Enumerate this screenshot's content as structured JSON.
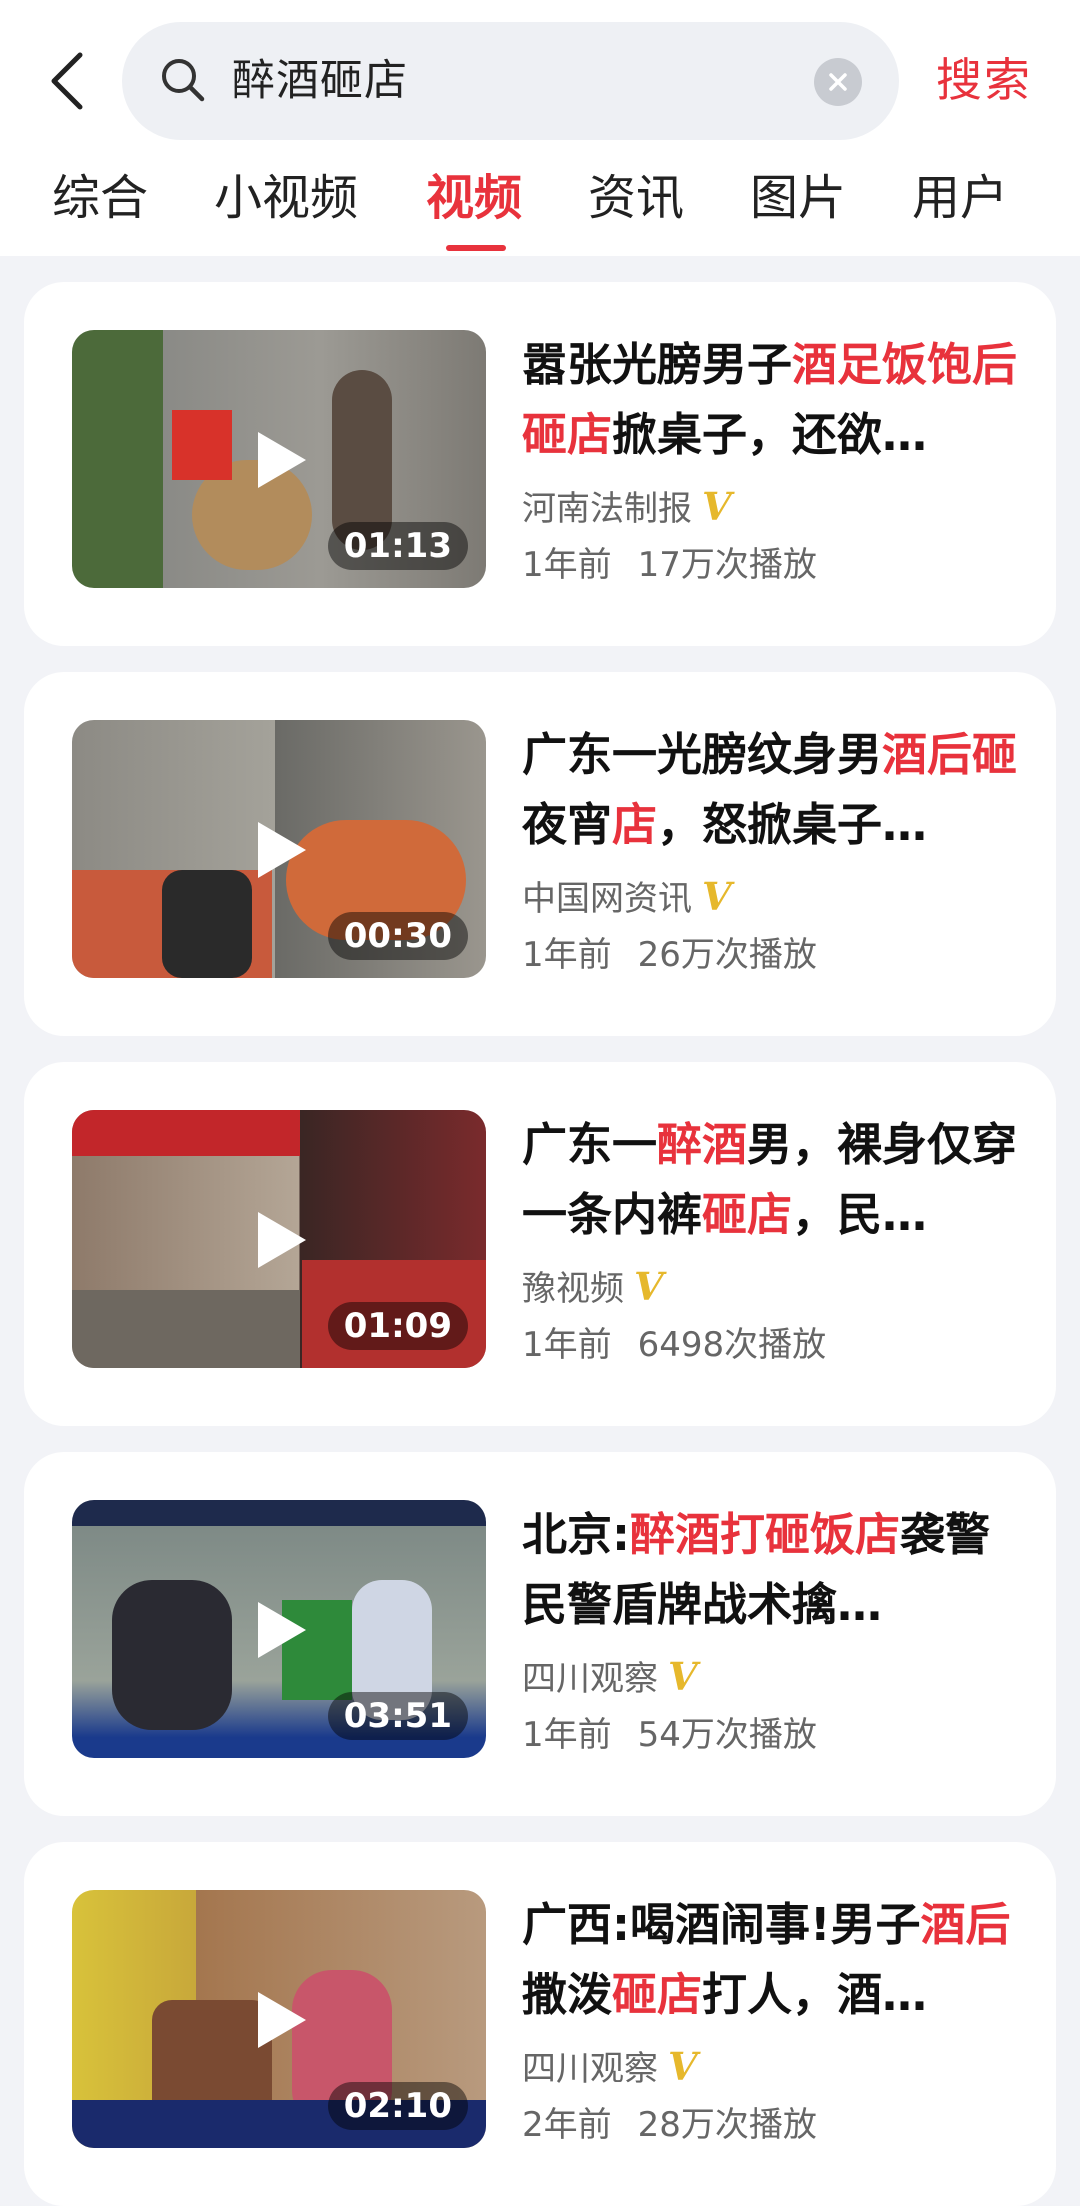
{
  "search": {
    "query": "醉酒砸店",
    "button_label": "搜索"
  },
  "tabs": [
    {
      "label": "综合"
    },
    {
      "label": "小视频"
    },
    {
      "label": "视频",
      "active": true
    },
    {
      "label": "资讯"
    },
    {
      "label": "图片"
    },
    {
      "label": "用户"
    }
  ],
  "colors": {
    "accent": "#e8323c",
    "verified": "#e6b82c"
  },
  "results": [
    {
      "title_parts": [
        {
          "text": "嚣张光膀男子",
          "hl": false
        },
        {
          "text": "酒足饭饱后砸店",
          "hl": true
        },
        {
          "text": "掀桌子，还欲…",
          "hl": false
        }
      ],
      "source": "河南法制报",
      "verified_mark": "V",
      "time": "1年前",
      "views": "17万次播放",
      "duration": "01:13"
    },
    {
      "title_parts": [
        {
          "text": "广东一光膀纹身男",
          "hl": false
        },
        {
          "text": "酒后砸",
          "hl": true
        },
        {
          "text": "夜宵",
          "hl": false
        },
        {
          "text": "店",
          "hl": true
        },
        {
          "text": "，怒掀桌子…",
          "hl": false
        }
      ],
      "source": "中国网资讯",
      "verified_mark": "V",
      "time": "1年前",
      "views": "26万次播放",
      "duration": "00:30"
    },
    {
      "title_parts": [
        {
          "text": "广东一",
          "hl": false
        },
        {
          "text": "醉酒",
          "hl": true
        },
        {
          "text": "男，裸身仅穿一条内裤",
          "hl": false
        },
        {
          "text": "砸店",
          "hl": true
        },
        {
          "text": "，民…",
          "hl": false
        }
      ],
      "source": "豫视频",
      "verified_mark": "V",
      "time": "1年前",
      "views": "6498次播放",
      "duration": "01:09"
    },
    {
      "title_parts": [
        {
          "text": "北京:",
          "hl": false
        },
        {
          "text": "醉酒打砸饭店",
          "hl": true
        },
        {
          "text": "袭警 民警盾牌战术擒…",
          "hl": false
        }
      ],
      "source": "四川观察",
      "verified_mark": "V",
      "time": "1年前",
      "views": "54万次播放",
      "duration": "03:51"
    },
    {
      "title_parts": [
        {
          "text": "广西:喝酒闹事!男子",
          "hl": false
        },
        {
          "text": "酒后",
          "hl": true
        },
        {
          "text": "撒泼",
          "hl": false
        },
        {
          "text": "砸店",
          "hl": true
        },
        {
          "text": "打人，酒…",
          "hl": false
        }
      ],
      "source": "四川观察",
      "verified_mark": "V",
      "time": "2年前",
      "views": "28万次播放",
      "duration": "02:10"
    }
  ]
}
